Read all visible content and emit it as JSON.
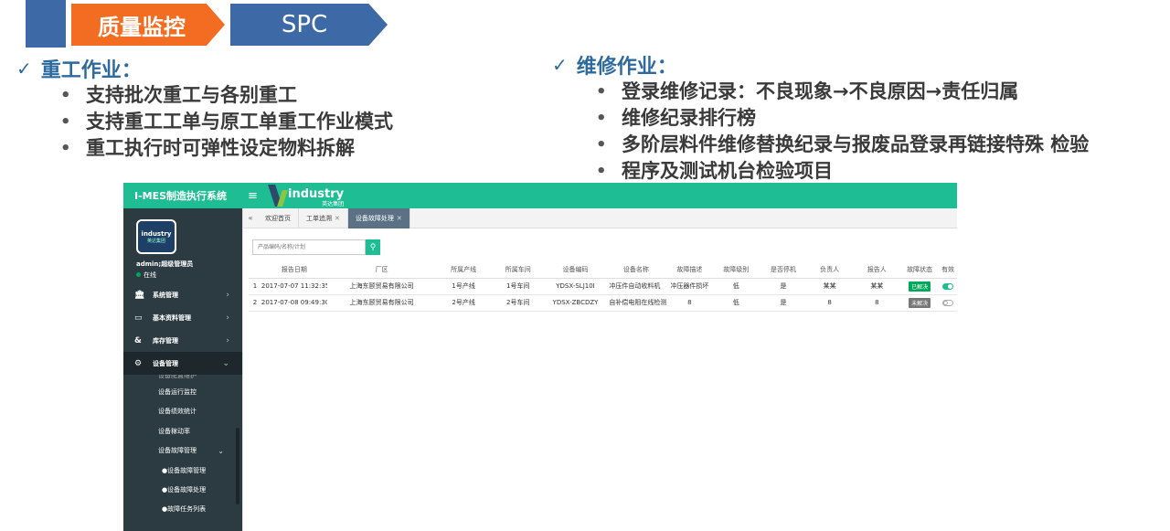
{
  "header": {
    "tab_active": "质量监控",
    "tab_next": "SPC"
  },
  "left_section": {
    "title": "重工作业：",
    "items": [
      "支持批次重工与各别重工",
      "支持重工工单与原工单重工作业模式",
      "重工执行时可弹性设定物料拆解"
    ]
  },
  "right_section": {
    "title": "维修作业：",
    "items": [
      "登录维修记录：不良现象→不良原因→责任归属",
      "维修纪录排行榜",
      "多阶层料件维修替换纪录与报废品登录再链接特殊 检验",
      "程序及测试机台检验项目"
    ]
  },
  "app": {
    "title": "I-MES制造执行系统",
    "logo_text": "industry",
    "logo_sub": "英达集团",
    "avatar_text": "industry",
    "avatar_sub": "英达集团",
    "user_name": "admin;超级管理员",
    "user_status": "在线",
    "menu": [
      "系统管理",
      "基本资料管理",
      "库存管理",
      "设备管理"
    ],
    "submenu_cut": "设备配置维护",
    "submenu": [
      "设备运行监控",
      "设备绩效统计",
      "设备稼动率",
      "设备故障管理"
    ],
    "submenu2": [
      "●设备故障管理",
      "●设备故障处理",
      "●故障任务列表"
    ],
    "tabs": [
      "欢迎首页",
      "工单追溯",
      "设备故障处理"
    ],
    "search_placeholder": "产品编码/名称/计划",
    "columns": [
      "",
      "报告日期",
      "厂区",
      "所属产线",
      "所属车间",
      "设备编码",
      "设备名称",
      "故障描述",
      "故障级别",
      "是否停机",
      "负责人",
      "报告人",
      "故障状态",
      "有效"
    ],
    "rows": [
      {
        "no": "1",
        "date": "2017-07-07 11:32:35",
        "plant": "上海东颐贸易有限公司",
        "line": "1号产线",
        "shop": "1号车间",
        "code": "YDSX-SLJ10I",
        "name": "冲压件自动收料机",
        "desc": "冲压器件损坏",
        "level": "低",
        "stop": "是",
        "owner": "某某",
        "reporter": "某某",
        "status": "已解决",
        "status_color": "#00a65a",
        "active": true
      },
      {
        "no": "2",
        "date": "2017-07-08 09:49:30",
        "plant": "上海东颐贸易有限公司",
        "line": "2号产线",
        "shop": "2号车间",
        "code": "YDSX-ZBCDZY",
        "name": "自补偿电阻在线检测",
        "desc": "8",
        "level": "低",
        "stop": "是",
        "owner": "8",
        "reporter": "8",
        "status": "未解决",
        "status_color": "#777777",
        "active": false
      }
    ]
  },
  "colors": {
    "accent_orange": "#f26d21",
    "accent_blue": "#3d6aa6",
    "app_green": "#1fbd93",
    "sidebar_dark": "#2c3b41"
  }
}
